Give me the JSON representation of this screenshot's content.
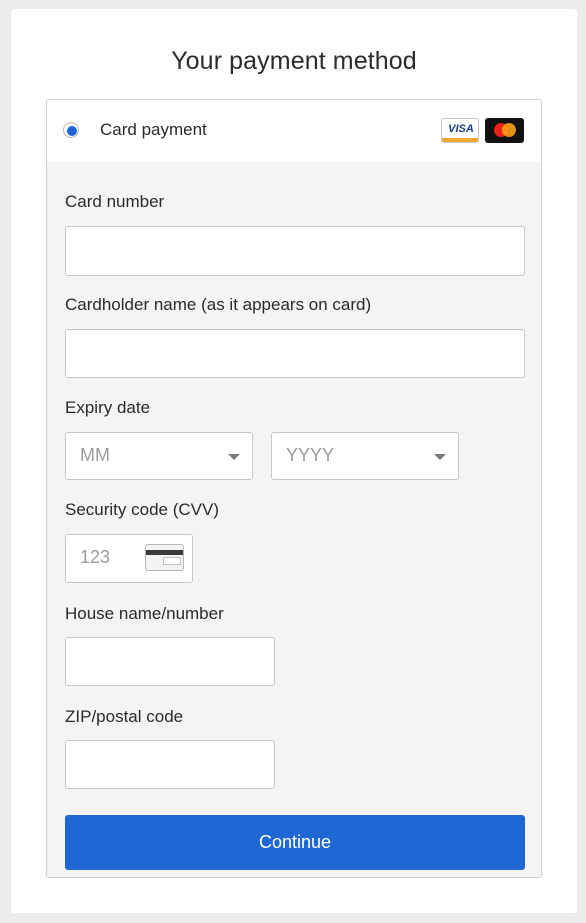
{
  "page": {
    "title": "Your payment method"
  },
  "payment_method": {
    "label": "Card payment",
    "selected": true,
    "card_brands": [
      {
        "name": "visa-logo",
        "text": "VISA"
      },
      {
        "name": "mastercard-logo",
        "text": ""
      }
    ]
  },
  "form": {
    "card_number": {
      "label": "Card number",
      "value": "",
      "placeholder": ""
    },
    "cardholder_name": {
      "label": "Cardholder name (as it appears on card)",
      "value": "",
      "placeholder": ""
    },
    "expiry": {
      "label": "Expiry date",
      "month_placeholder": "MM",
      "year_placeholder": "YYYY"
    },
    "cvv": {
      "label": "Security code (CVV)",
      "placeholder": "123",
      "icon": "card-back-icon"
    },
    "house": {
      "label": "House name/number",
      "value": "",
      "placeholder": ""
    },
    "zip": {
      "label": "ZIP/postal code",
      "value": "",
      "placeholder": ""
    }
  },
  "actions": {
    "continue_label": "Continue"
  },
  "colors": {
    "accent": "#1f67d2",
    "panel_bg": "#f4f4f4",
    "border": "#c8c8c8"
  }
}
